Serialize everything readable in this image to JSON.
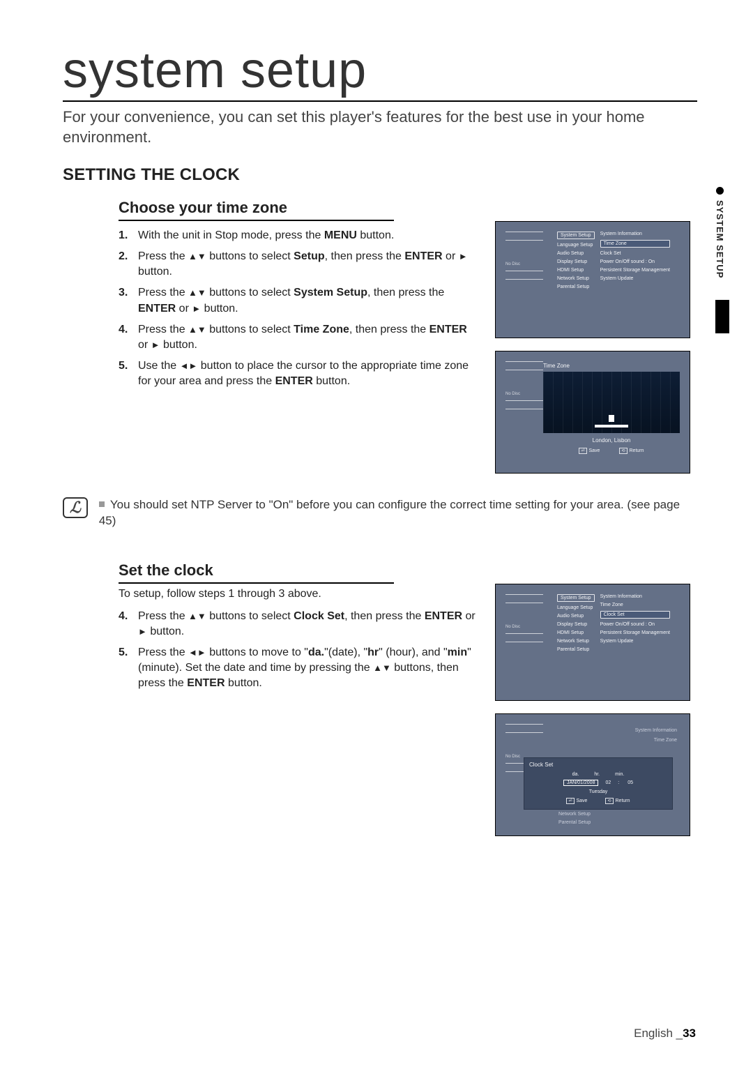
{
  "page": {
    "title": "system setup",
    "intro": "For your convenience, you can set this player's features for the best use in your home environment.",
    "section_tab": "SYSTEM SETUP"
  },
  "sectionA": {
    "heading": "SETTING THE CLOCK",
    "sub1": "Choose your time zone",
    "steps1": [
      {
        "n": "1.",
        "pre": "With the unit in Stop mode, press the ",
        "b1": "MENU",
        "post1": " button."
      },
      {
        "n": "2.",
        "pre": "Press the ",
        "sym": "▲▼",
        "mid": " buttons to select ",
        "b1": "Setup",
        "post1": ", then press the ",
        "b2": "ENTER",
        "post2": " or ",
        "sym2": "►",
        "post3": " button."
      },
      {
        "n": "3.",
        "pre": "Press the ",
        "sym": "▲▼",
        "mid": " buttons to select ",
        "b1": "System Setup",
        "post1": ", then press the ",
        "b2": "ENTER",
        "post2": " or ",
        "sym2": "►",
        "post3": " button."
      },
      {
        "n": "4.",
        "pre": "Press the ",
        "sym": "▲▼",
        "mid": " buttons to select ",
        "b1": "Time Zone",
        "post1": ", then press the ",
        "b2": "ENTER",
        "post2": " or ",
        "sym2": "►",
        "post3": " button."
      },
      {
        "n": "5.",
        "pre": "Use the ",
        "sym": "◄►",
        "mid": " button to place the cursor to the appropriate time zone for your area and press the ",
        "b1": "ENTER",
        "post1": " button."
      }
    ],
    "note": "You should set NTP Server to \"On\" before you can configure the correct time setting for your area. (see page 45)",
    "sub2": "Set the clock",
    "lead2": "To setup, follow steps 1 through 3 above.",
    "steps2": [
      {
        "n": "4.",
        "pre": "Press the ",
        "sym": "▲▼",
        "mid": " buttons to select ",
        "b1": "Clock Set",
        "post1": ", then press the ",
        "b2": "ENTER",
        "post2": " or ",
        "sym2": "►",
        "post3": " button."
      },
      {
        "n": "5.",
        "pre": "Press the ",
        "sym": "◄►",
        "mid": " buttons to move to \"",
        "b1": "da.",
        "post1": "\"(date), \"",
        "b2": "hr",
        "post2": "\" (hour), and \"",
        "b3": "min",
        "post3": "\" (minute). Set the date and time by pressing the ",
        "sym2": "▲▼",
        "post4": " buttons, then press the ",
        "b4": "ENTER",
        "post5": " button."
      }
    ]
  },
  "shot_menu": {
    "no_disc": "No Disc",
    "left": [
      "System Setup",
      "Language Setup",
      "Audio Setup",
      "Display Setup",
      "HDMI Setup",
      "Network Setup",
      "Parental Setup"
    ],
    "right_top": [
      "System Information",
      "Time Zone",
      "Clock Set",
      "Power On/Off sound   :  On",
      "Persistent Storage Management",
      "System Update"
    ],
    "sel_left": "System Setup",
    "hl_right_1": "Time Zone",
    "hl_right_2": "Clock Set"
  },
  "shot_map": {
    "label": "Time Zone",
    "city": "London, Lisbon",
    "save": "Save",
    "return": "Return"
  },
  "shot_popup": {
    "title": "Clock Set",
    "cols": {
      "da": "da.",
      "hr": "hr.",
      "min": "min."
    },
    "vals": {
      "date": "JAN/01/2008",
      "hr": "02",
      "min": "05"
    },
    "day": "Tuesday",
    "save": "Save",
    "return": "Return"
  },
  "footer": {
    "lang": "English _",
    "page": "33"
  }
}
